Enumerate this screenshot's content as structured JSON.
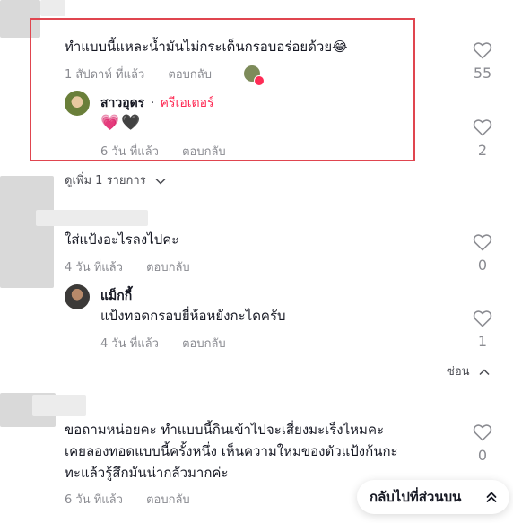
{
  "comments": {
    "c1": {
      "text": "ทำแบบนี้แหละน้ำมันไม่กระเด็นกรอบอร่อยด้วย😂",
      "time": "1 สัปดาห์ ที่แล้ว",
      "reply_label": "ตอบกลับ",
      "likes": "55",
      "reply": {
        "author": "สาวอุดร",
        "separator": "·",
        "creator_label": "ครีเอเตอร์",
        "emojis": "💗🖤",
        "time": "6 วัน ที่แล้ว",
        "reply_label": "ตอบกลับ",
        "likes": "2"
      },
      "view_more": "ดูเพิ่ม 1 รายการ"
    },
    "c2": {
      "text": "ใส่แป้งอะไรลงไปคะ",
      "time": "4 วัน ที่แล้ว",
      "reply_label": "ตอบกลับ",
      "likes": "0",
      "reply": {
        "author": "แม็กกี้",
        "text": "แป้งทอดกรอบยี่ห้อหยังกะไดครับ",
        "time": "4 วัน ที่แล้ว",
        "reply_label": "ตอบกลับ",
        "likes": "1"
      },
      "hide_label": "ซ่อน"
    },
    "c3": {
      "lines": [
        "ขอถามหน่อยคะ ทำแบบนี้กินเข้าไปจะเสี่ยงมะเร็งไหมคะ",
        "เคยลองทอดแบบนี้ครั้งหนึ่ง เห็นความใหมของตัวแป้งก้นกะ",
        "ทะแล้วรู้สึกมันน่ากลัวมากค่ะ"
      ],
      "time": "6 วัน ที่แล้ว",
      "reply_label": "ตอบกลับ",
      "likes": "0"
    }
  },
  "back_to_top": "กลับไปที่ส่วนบน",
  "colors": {
    "highlight": "#e0454f",
    "creator": "#fe2c55",
    "muted": "#8a8b91"
  }
}
